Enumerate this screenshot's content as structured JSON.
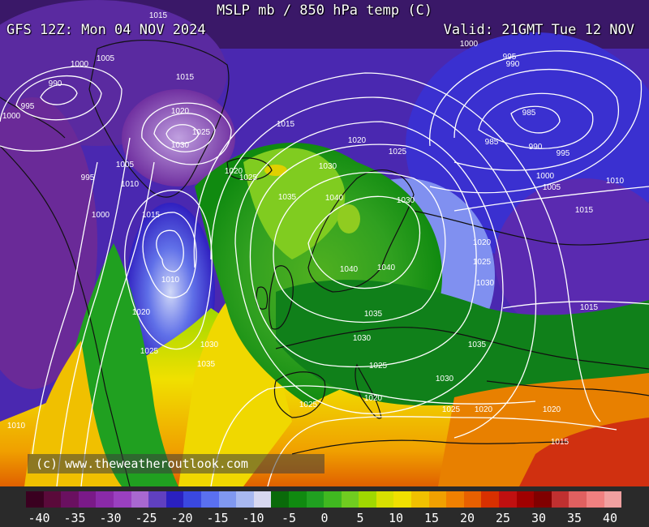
{
  "header": {
    "title": "MSLP mb / 850 hPa temp (C)",
    "run": "GFS 12Z: Mon 04 NOV 2024",
    "valid": "Valid: 21GMT Tue 12 NOV"
  },
  "credit": "(c) www.theweatheroutlook.com",
  "legend": {
    "tick_labels": [
      "-40",
      "-35",
      "-30",
      "-25",
      "-20",
      "-15",
      "-10",
      "-5",
      "0",
      "5",
      "10",
      "15",
      "20",
      "25",
      "30",
      "35",
      "40"
    ],
    "colors": [
      "#3a0020",
      "#5a0a3a",
      "#6a1060",
      "#7a1a88",
      "#8a2aa8",
      "#9a40c0",
      "#a868d0",
      "#6040c0",
      "#2a20c0",
      "#3a48e0",
      "#5a70f0",
      "#8098f0",
      "#a8b8f0",
      "#d8d8f0",
      "#0a6a0a",
      "#108a10",
      "#20a020",
      "#40b820",
      "#70cc20",
      "#a0d800",
      "#d8e000",
      "#f0e000",
      "#f0c000",
      "#f0a000",
      "#f08000",
      "#e86000",
      "#d83000",
      "#c01010",
      "#a00000",
      "#800000",
      "#c03030",
      "#e06060",
      "#f08080",
      "#f0a0a0"
    ]
  },
  "isobar_labels": [
    "1015",
    "1005",
    "1000",
    "990",
    "995",
    "1000",
    "1015",
    "1020",
    "1025",
    "1030",
    "1015",
    "1020",
    "1025",
    "1030",
    "1035",
    "1040",
    "1040",
    "1040",
    "1035",
    "1030",
    "1025",
    "1020",
    "1000",
    "995",
    "990",
    "985",
    "985",
    "990",
    "995",
    "1000",
    "1005",
    "1010",
    "1015",
    "1020",
    "1025",
    "1030",
    "1035",
    "1030",
    "1025",
    "1020",
    "1015",
    "1010",
    "1005",
    "1000",
    "995",
    "1010",
    "1015",
    "1020",
    "1025",
    "1030",
    "1035",
    "1025",
    "1020",
    "1015",
    "1010",
    "1020",
    "1025",
    "1030"
  ]
}
